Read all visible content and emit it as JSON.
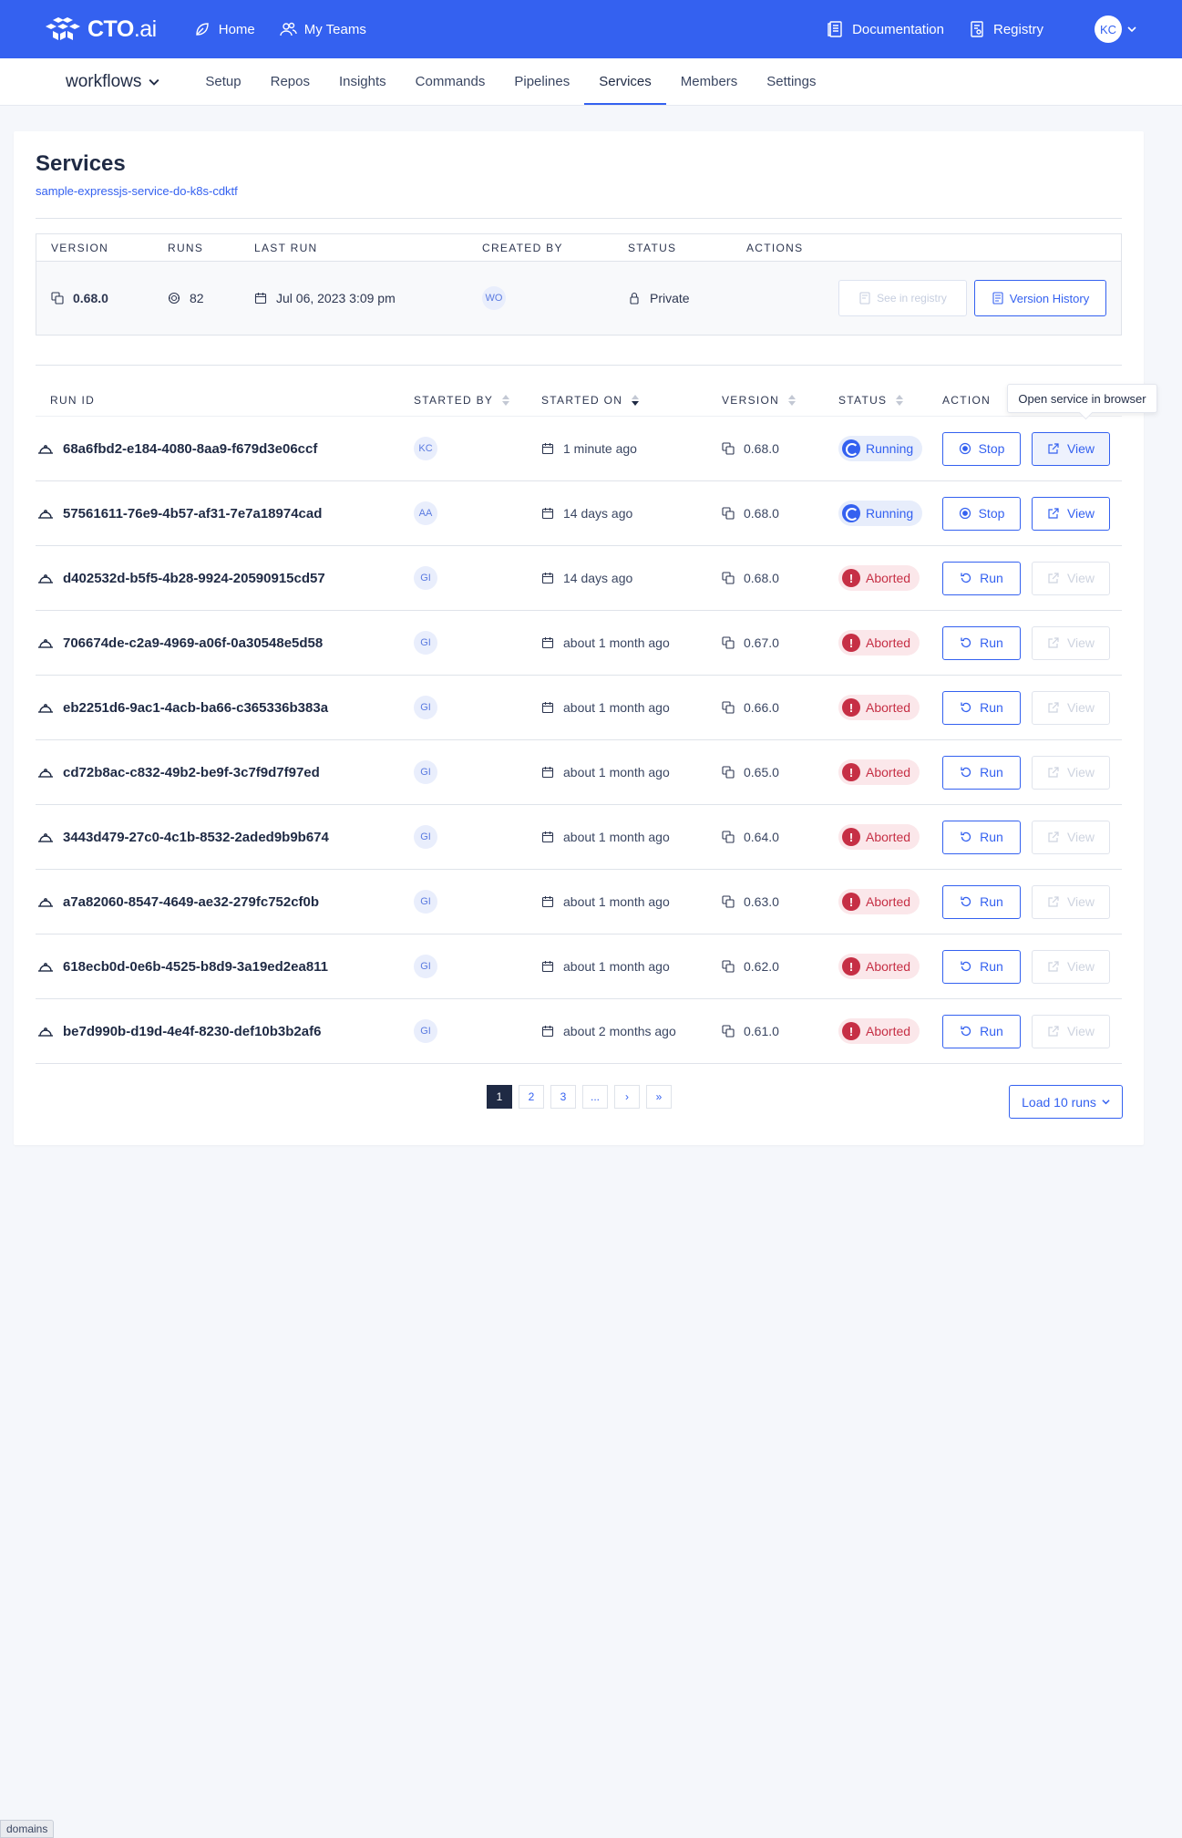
{
  "topbar": {
    "logo_brand": "CTO",
    "logo_suffix": ".ai",
    "home": "Home",
    "my_teams": "My Teams",
    "documentation": "Documentation",
    "registry": "Registry",
    "avatar": "KC"
  },
  "subnav": {
    "workflows": "workflows",
    "tabs": [
      "Setup",
      "Repos",
      "Insights",
      "Commands",
      "Pipelines",
      "Services",
      "Members",
      "Settings"
    ],
    "active": "Services"
  },
  "page": {
    "title": "Services",
    "service_name": "sample-expressjs-service-do-k8s-cdktf"
  },
  "info": {
    "headers": [
      "VERSION",
      "RUNS",
      "LAST RUN",
      "CREATED BY",
      "STATUS",
      "ACTIONS"
    ],
    "version": "0.68.0",
    "runs": "82",
    "last_run": "Jul 06, 2023 3:09 pm",
    "created_by": "WO",
    "status": "Private",
    "see_registry": "See in registry",
    "version_history": "Version History"
  },
  "runs": {
    "headers": [
      "RUN ID",
      "STARTED BY",
      "STARTED ON",
      "VERSION",
      "STATUS",
      "ACTION"
    ],
    "rows": [
      {
        "id": "68a6fbd2-e184-4080-8aa9-f679d3e06ccf",
        "by": "KC",
        "on": "1 minute ago",
        "version": "0.68.0",
        "status": "Running",
        "primary": "Stop",
        "view": "View"
      },
      {
        "id": "57561611-76e9-4b57-af31-7e7a18974cad",
        "by": "AA",
        "on": "14 days ago",
        "version": "0.68.0",
        "status": "Running",
        "primary": "Stop",
        "view": "View"
      },
      {
        "id": "d402532d-b5f5-4b28-9924-20590915cd57",
        "by": "GI",
        "on": "14 days ago",
        "version": "0.68.0",
        "status": "Aborted",
        "primary": "Run",
        "view": "View"
      },
      {
        "id": "706674de-c2a9-4969-a06f-0a30548e5d58",
        "by": "GI",
        "on": "about 1 month ago",
        "version": "0.67.0",
        "status": "Aborted",
        "primary": "Run",
        "view": "View"
      },
      {
        "id": "eb2251d6-9ac1-4acb-ba66-c365336b383a",
        "by": "GI",
        "on": "about 1 month ago",
        "version": "0.66.0",
        "status": "Aborted",
        "primary": "Run",
        "view": "View"
      },
      {
        "id": "cd72b8ac-c832-49b2-be9f-3c7f9d7f97ed",
        "by": "GI",
        "on": "about 1 month ago",
        "version": "0.65.0",
        "status": "Aborted",
        "primary": "Run",
        "view": "View"
      },
      {
        "id": "3443d479-27c0-4c1b-8532-2aded9b9b674",
        "by": "GI",
        "on": "about 1 month ago",
        "version": "0.64.0",
        "status": "Aborted",
        "primary": "Run",
        "view": "View"
      },
      {
        "id": "a7a82060-8547-4649-ae32-279fc752cf0b",
        "by": "GI",
        "on": "about 1 month ago",
        "version": "0.63.0",
        "status": "Aborted",
        "primary": "Run",
        "view": "View"
      },
      {
        "id": "618ecb0d-0e6b-4525-b8d9-3a19ed2ea811",
        "by": "GI",
        "on": "about 1 month ago",
        "version": "0.62.0",
        "status": "Aborted",
        "primary": "Run",
        "view": "View"
      },
      {
        "id": "be7d990b-d19d-4e4f-8230-def10b3b2af6",
        "by": "GI",
        "on": "about 2 months ago",
        "version": "0.61.0",
        "status": "Aborted",
        "primary": "Run",
        "view": "View"
      }
    ]
  },
  "tooltip": "Open service in browser",
  "pagination": [
    "1",
    "2",
    "3",
    "...",
    "›",
    "»"
  ],
  "load_more": "Load 10 runs",
  "bottom_chip": "domains",
  "colors": {
    "primary": "#3461f0",
    "running": "#3461f0",
    "aborted": "#c62f45"
  }
}
